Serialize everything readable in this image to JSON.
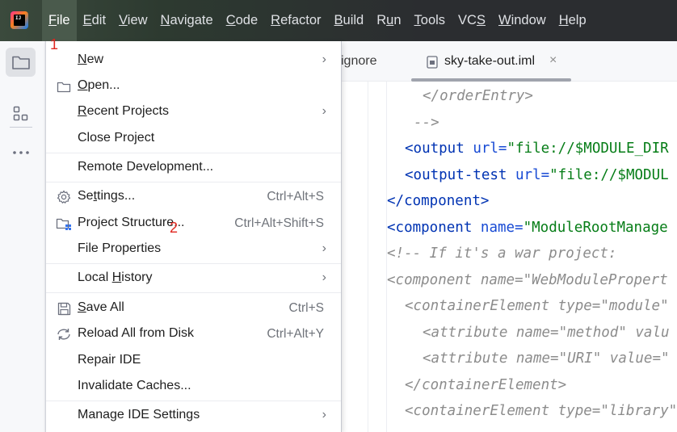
{
  "menubar": {
    "logo_text": "IJ",
    "items": [
      {
        "pre": "",
        "mn": "F",
        "post": "ile",
        "active": true
      },
      {
        "pre": "",
        "mn": "E",
        "post": "dit"
      },
      {
        "pre": "",
        "mn": "V",
        "post": "iew"
      },
      {
        "pre": "",
        "mn": "N",
        "post": "avigate"
      },
      {
        "pre": "",
        "mn": "C",
        "post": "ode"
      },
      {
        "pre": "",
        "mn": "R",
        "post": "efactor"
      },
      {
        "pre": "",
        "mn": "B",
        "post": "uild"
      },
      {
        "pre": "R",
        "mn": "u",
        "post": "n"
      },
      {
        "pre": "",
        "mn": "T",
        "post": "ools"
      },
      {
        "pre": "VC",
        "mn": "S",
        "post": ""
      },
      {
        "pre": "",
        "mn": "W",
        "post": "indow"
      },
      {
        "pre": "",
        "mn": "H",
        "post": "elp"
      }
    ]
  },
  "annotations": {
    "first": "1",
    "second": "2"
  },
  "tabs": {
    "partial_label": "ignore",
    "active_label": "sky-take-out.iml",
    "close_glyph": "×"
  },
  "file_menu": {
    "new": {
      "pre": "",
      "mn": "N",
      "post": "ew"
    },
    "open": {
      "pre": "",
      "mn": "O",
      "post": "pen..."
    },
    "recent_projects": {
      "pre": "",
      "mn": "R",
      "post": "ecent Projects"
    },
    "close_project": {
      "label": "Close Project"
    },
    "remote_development": {
      "label": "Remote Development..."
    },
    "settings": {
      "pre": "Se",
      "mn": "t",
      "post": "tings...",
      "shortcut": "Ctrl+Alt+S"
    },
    "project_structure": {
      "label": "Project Structure...",
      "shortcut": "Ctrl+Alt+Shift+S"
    },
    "file_properties": {
      "label": "File Properties"
    },
    "local_history": {
      "pre": "Local ",
      "mn": "H",
      "post": "istory"
    },
    "save_all": {
      "pre": "",
      "mn": "S",
      "post": "ave All",
      "shortcut": "Ctrl+S"
    },
    "reload_all": {
      "label": "Reload All from Disk",
      "shortcut": "Ctrl+Alt+Y"
    },
    "repair_ide": {
      "label": "Repair IDE"
    },
    "invalidate_caches": {
      "label": "Invalidate Caches..."
    },
    "manage_ide_settings": {
      "label": "Manage IDE Settings"
    }
  },
  "code": {
    "l1_tag": "</orderEntry>",
    "l2_com": "-->",
    "l3_open": "<output",
    "l3_attr": "url=",
    "l3_val": "\"file://$MODULE_DIR",
    "l4_open": "<output-test",
    "l4_attr": "url=",
    "l4_val": "\"file://$MODUL",
    "l5_tag": "</component>",
    "l6_open": "<component",
    "l6_attr": "name=",
    "l6_val": "\"ModuleRootManage",
    "l7": "<!-- If it's a war project:",
    "l8": "<component name=\"WebModulePropert",
    "l9": "<containerElement type=\"module\"",
    "l10": "<attribute name=\"method\" valu",
    "l11": "<attribute name=\"URI\" value=\"",
    "l12": "</containerElement>",
    "l13": "<containerElement type=\"library\""
  }
}
